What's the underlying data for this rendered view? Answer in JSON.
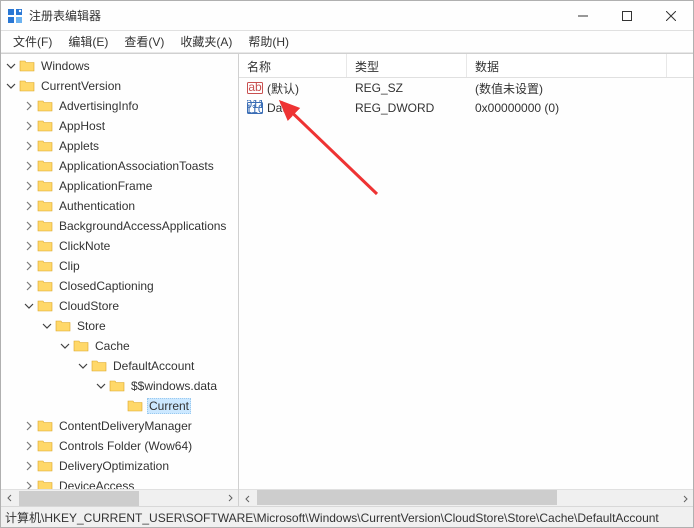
{
  "window": {
    "title": "注册表编辑器"
  },
  "menu": {
    "file": "文件(F)",
    "edit": "编辑(E)",
    "view": "查看(V)",
    "favorites": "收藏夹(A)",
    "help": "帮助(H)"
  },
  "tree": {
    "root": "Windows",
    "currentVersion": "CurrentVersion",
    "items": [
      "AdvertisingInfo",
      "AppHost",
      "Applets",
      "ApplicationAssociationToasts",
      "ApplicationFrame",
      "Authentication",
      "BackgroundAccessApplications",
      "ClickNote",
      "Clip",
      "ClosedCaptioning"
    ],
    "cloudStore": "CloudStore",
    "store": "Store",
    "cache": "Cache",
    "defaultAccount": "DefaultAccount",
    "windowsData": "$$windows.data",
    "current": "Current",
    "items2": [
      "ContentDeliveryManager",
      "Controls Folder (Wow64)",
      "DeliveryOptimization",
      "DeviceAccess"
    ]
  },
  "list": {
    "col_name": "名称",
    "col_type": "类型",
    "col_data": "数据",
    "rows": [
      {
        "name": "(默认)",
        "type": "REG_SZ",
        "data": "(数值未设置)",
        "icon": "ab"
      },
      {
        "name": "Data",
        "type": "REG_DWORD",
        "data": "0x00000000 (0)",
        "icon": "bin"
      }
    ]
  },
  "status": {
    "path": "计算机\\HKEY_CURRENT_USER\\SOFTWARE\\Microsoft\\Windows\\CurrentVersion\\CloudStore\\Store\\Cache\\DefaultAccount"
  },
  "cols": {
    "name": 108,
    "type": 120,
    "data": 200
  }
}
